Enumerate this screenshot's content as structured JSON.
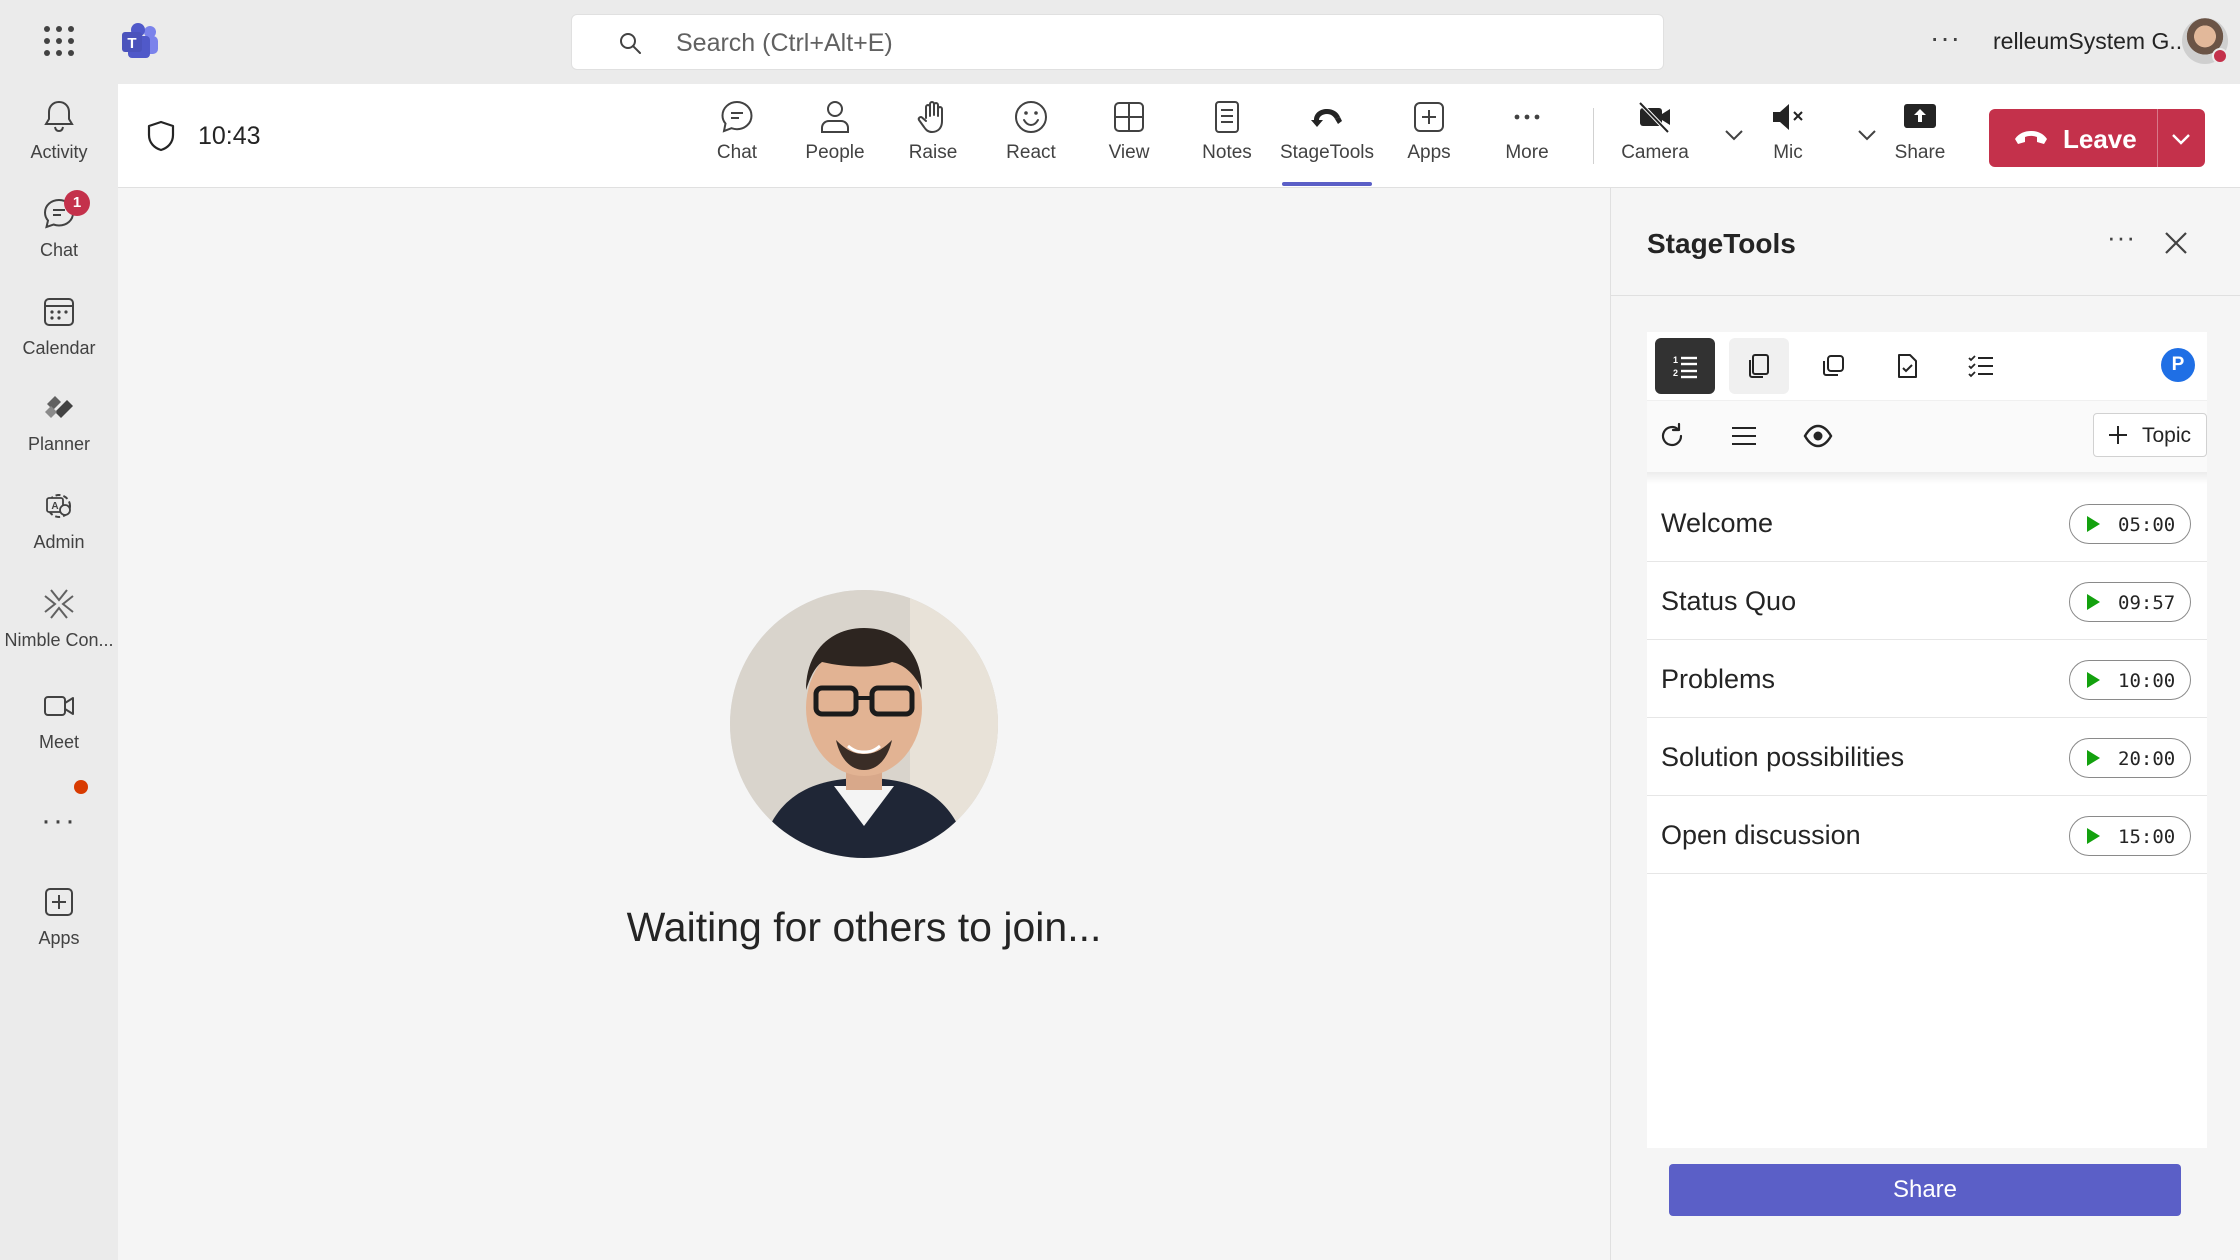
{
  "search": {
    "placeholder": "Search (Ctrl+Alt+E)"
  },
  "user": {
    "name": "relleumSystem G..."
  },
  "rail": {
    "items": [
      {
        "label": "Activity",
        "icon": "bell-icon"
      },
      {
        "label": "Chat",
        "icon": "chat-icon",
        "badge": "1"
      },
      {
        "label": "Calendar",
        "icon": "calendar-icon"
      },
      {
        "label": "Planner",
        "icon": "planner-icon"
      },
      {
        "label": "Admin",
        "icon": "admin-icon"
      },
      {
        "label": "Nimble Con...",
        "icon": "nimble-icon"
      },
      {
        "label": "Meet",
        "icon": "video-icon"
      },
      {
        "label": "Apps",
        "icon": "add-apps-icon"
      }
    ]
  },
  "meeting": {
    "time": "10:43",
    "toolbar": [
      {
        "label": "Chat",
        "icon": "chat-icon"
      },
      {
        "label": "People",
        "icon": "person-icon"
      },
      {
        "label": "Raise",
        "icon": "hand-icon"
      },
      {
        "label": "React",
        "icon": "smiley-icon"
      },
      {
        "label": "View",
        "icon": "grid-view-icon"
      },
      {
        "label": "Notes",
        "icon": "notes-icon"
      },
      {
        "label": "StageTools",
        "icon": "stagetools-icon"
      },
      {
        "label": "Apps",
        "icon": "add-apps-icon"
      },
      {
        "label": "More",
        "icon": "more-icon"
      },
      {
        "label": "Camera",
        "icon": "camera-off-icon"
      },
      {
        "label": "Mic",
        "icon": "mic-muted-icon"
      },
      {
        "label": "Share",
        "icon": "share-tray-icon"
      }
    ],
    "leave_label": "Leave",
    "waiting_text": "Waiting for others to join..."
  },
  "panel": {
    "title": "StageTools",
    "avatar_letter": "P",
    "add_topic_label": "Topic",
    "topics": [
      {
        "name": "Welcome",
        "time": "05:00"
      },
      {
        "name": "Status Quo",
        "time": "09:57"
      },
      {
        "name": "Problems",
        "time": "10:00"
      },
      {
        "name": "Solution possibilities",
        "time": "20:00"
      },
      {
        "name": "Open discussion",
        "time": "15:00"
      }
    ],
    "share_label": "Share"
  },
  "colors": {
    "accent": "#5b5fc7",
    "leave": "#c4314b",
    "play": "#13a10e",
    "badge": "#c4314b"
  }
}
